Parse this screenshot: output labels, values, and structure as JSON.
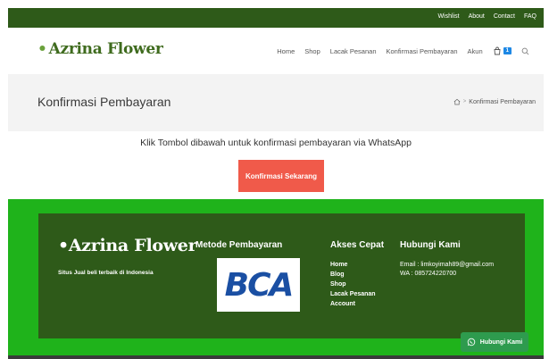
{
  "topbar": {
    "links": [
      "Wishlist",
      "About",
      "Contact",
      "FAQ"
    ],
    "bg_color": "#2e5a19"
  },
  "header": {
    "logo": {
      "dot": "•",
      "text": "Azrina Flower"
    },
    "nav": [
      "Home",
      "Shop",
      "Lacak Pesanan",
      "Konfirmasi Pembayaran",
      "Akun"
    ],
    "cart_icon": "shopping-bag-icon",
    "cart_count": "1",
    "search_icon": "search-icon"
  },
  "titlebar": {
    "title": "Konfirmasi Pembayaran",
    "breadcrumb": {
      "home_icon": "home-icon",
      "separator": ">",
      "current": "Konfirmasi Pembayaran"
    }
  },
  "content": {
    "instruction": "Klik Tombol dibawah untuk konfirmasi pembayaran via WhatsApp",
    "button_label": "Konfirmasi Sekarang",
    "button_color": "#f05a4a"
  },
  "footer": {
    "logo": {
      "dot": "•",
      "text": "Azrina Flower"
    },
    "tagline": "Situs Jual beli terbaik di Indonesia",
    "payment": {
      "heading": "Metode Pembayaran",
      "bank_logo_text": "BCA"
    },
    "quick_access": {
      "heading": "Akses Cepat",
      "links": [
        "Home",
        "Blog",
        "Shop",
        "Lacak Pesanan",
        "Account"
      ]
    },
    "contact": {
      "heading": "Hubungi Kami",
      "email": "Email : limkoyimah89@gmail.com",
      "wa": "WA : 085724220700"
    },
    "outer_color": "#1fb31b",
    "inner_color": "#2e5a19"
  },
  "whatsapp_float": {
    "label": "Hubungi Kami",
    "icon": "whatsapp-icon",
    "color": "#2e9b4e"
  }
}
